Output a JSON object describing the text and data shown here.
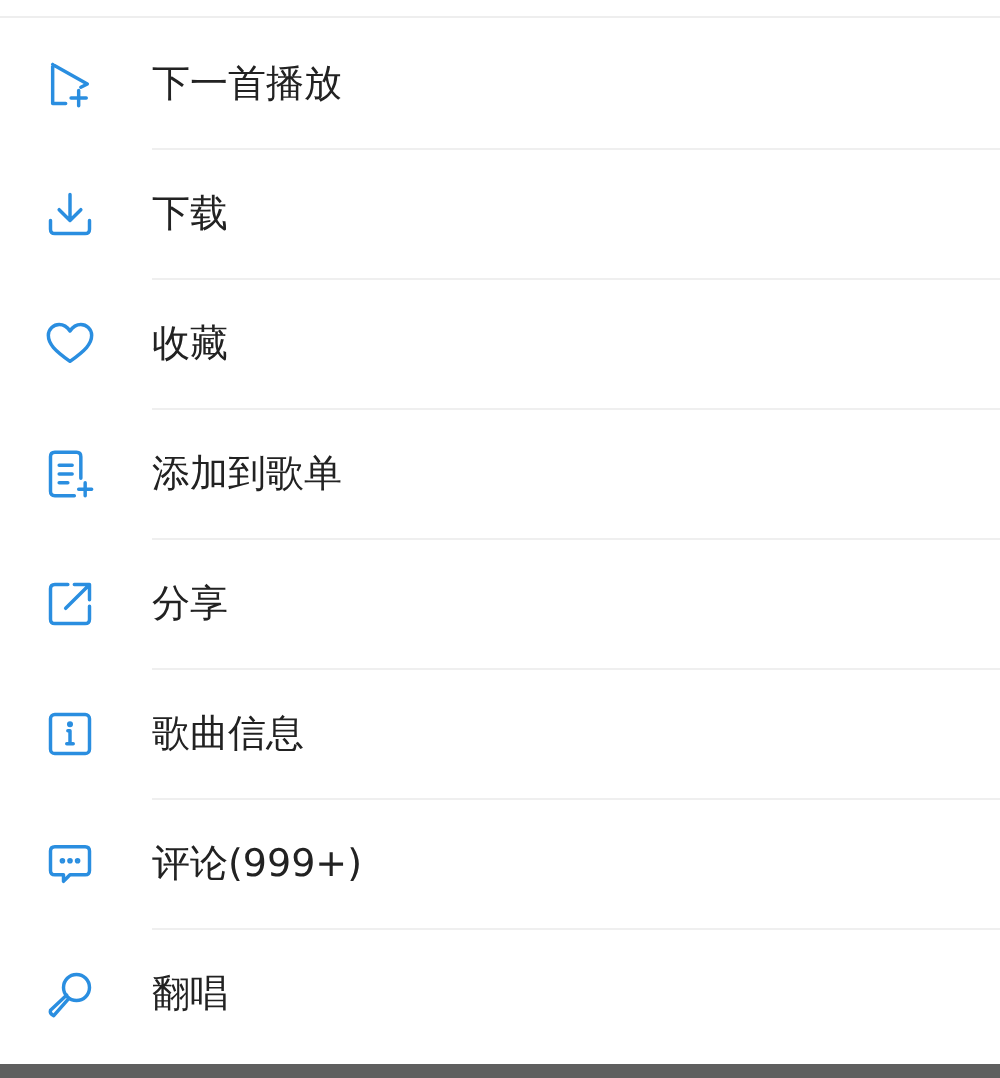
{
  "menu": [
    {
      "kind": "play-next",
      "label": "下一首播放"
    },
    {
      "kind": "download",
      "label": "下载"
    },
    {
      "kind": "favorite",
      "label": "收藏"
    },
    {
      "kind": "add-to-playlist",
      "label": "添加到歌单"
    },
    {
      "kind": "share",
      "label": "分享"
    },
    {
      "kind": "info",
      "label": "歌曲信息"
    },
    {
      "kind": "comment",
      "label": "评论(999+)"
    },
    {
      "kind": "cover",
      "label": "翻唱"
    }
  ]
}
